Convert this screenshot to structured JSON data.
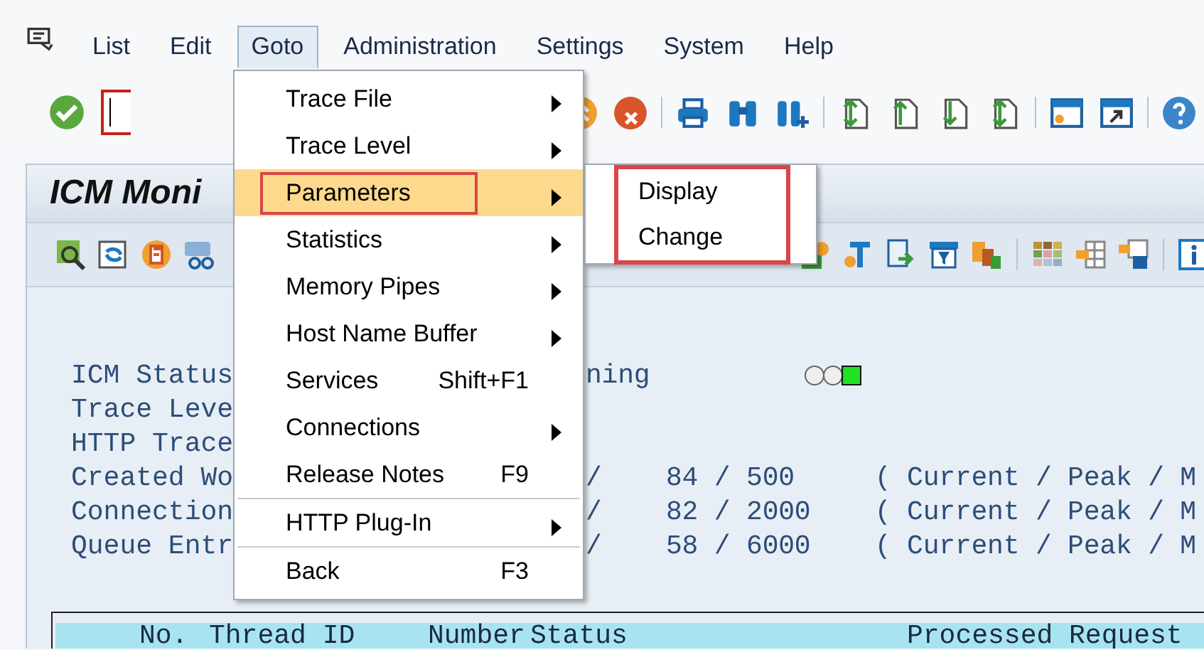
{
  "menu_bar": [
    {
      "label": "List",
      "selected": false
    },
    {
      "label": "Edit",
      "selected": false
    },
    {
      "label": "Goto",
      "selected": true
    },
    {
      "label": "Administration",
      "selected": false
    },
    {
      "label": "Settings",
      "selected": false
    },
    {
      "label": "System",
      "selected": false
    },
    {
      "label": "Help",
      "selected": false
    }
  ],
  "goto_menu": [
    {
      "kind": "item",
      "label": "Trace File",
      "has_submenu": true,
      "selected": false,
      "annotated": false
    },
    {
      "kind": "item",
      "label": "Trace Level",
      "has_submenu": true,
      "selected": false,
      "annotated": false
    },
    {
      "kind": "item",
      "label": "Parameters",
      "has_submenu": true,
      "selected": true,
      "annotated": true
    },
    {
      "kind": "item",
      "label": "Statistics",
      "has_submenu": true,
      "selected": false,
      "annotated": false
    },
    {
      "kind": "item",
      "label": "Memory Pipes",
      "has_submenu": true,
      "selected": false,
      "annotated": false
    },
    {
      "kind": "item",
      "label": "Host Name Buffer",
      "has_submenu": true,
      "selected": false,
      "annotated": false
    },
    {
      "kind": "item",
      "label": "Services",
      "shortcut": "Shift+F1",
      "has_submenu": false,
      "selected": false,
      "annotated": false
    },
    {
      "kind": "item",
      "label": "Connections",
      "has_submenu": true,
      "selected": false,
      "annotated": false
    },
    {
      "kind": "item",
      "label": "Release Notes",
      "shortcut": "F9",
      "has_submenu": false,
      "selected": false,
      "annotated": false
    },
    {
      "kind": "separator"
    },
    {
      "kind": "item",
      "label": "HTTP Plug-In",
      "has_submenu": true,
      "selected": false,
      "annotated": false
    },
    {
      "kind": "separator"
    },
    {
      "kind": "item",
      "label": "Back",
      "shortcut": "F3",
      "has_submenu": false,
      "selected": false,
      "annotated": false
    }
  ],
  "parameters_submenu": {
    "annotated": true,
    "items": [
      {
        "label": "Display"
      },
      {
        "label": "Change"
      }
    ]
  },
  "panel_title": "ICM Moni",
  "status_lines": [
    {
      "label": "ICM Status",
      "value": "ning"
    },
    {
      "label": "Trace Leve"
    },
    {
      "label": "HTTP Trace"
    },
    {
      "label": "Created Wo",
      "value": "/    84 / 500     ( Current / Peak / M"
    },
    {
      "label": "Connection",
      "value": "/    82 / 2000    ( Current / Peak / M"
    },
    {
      "label": "Queue Entr",
      "value": "/    58 / 6000    ( Current / Peak / M"
    }
  ],
  "status_lights": [
    {
      "on": false
    },
    {
      "on": false
    },
    {
      "on": true
    }
  ],
  "table": {
    "columns": [
      "No.",
      "Thread ID",
      "Number",
      "Status",
      "Processed Request"
    ]
  }
}
